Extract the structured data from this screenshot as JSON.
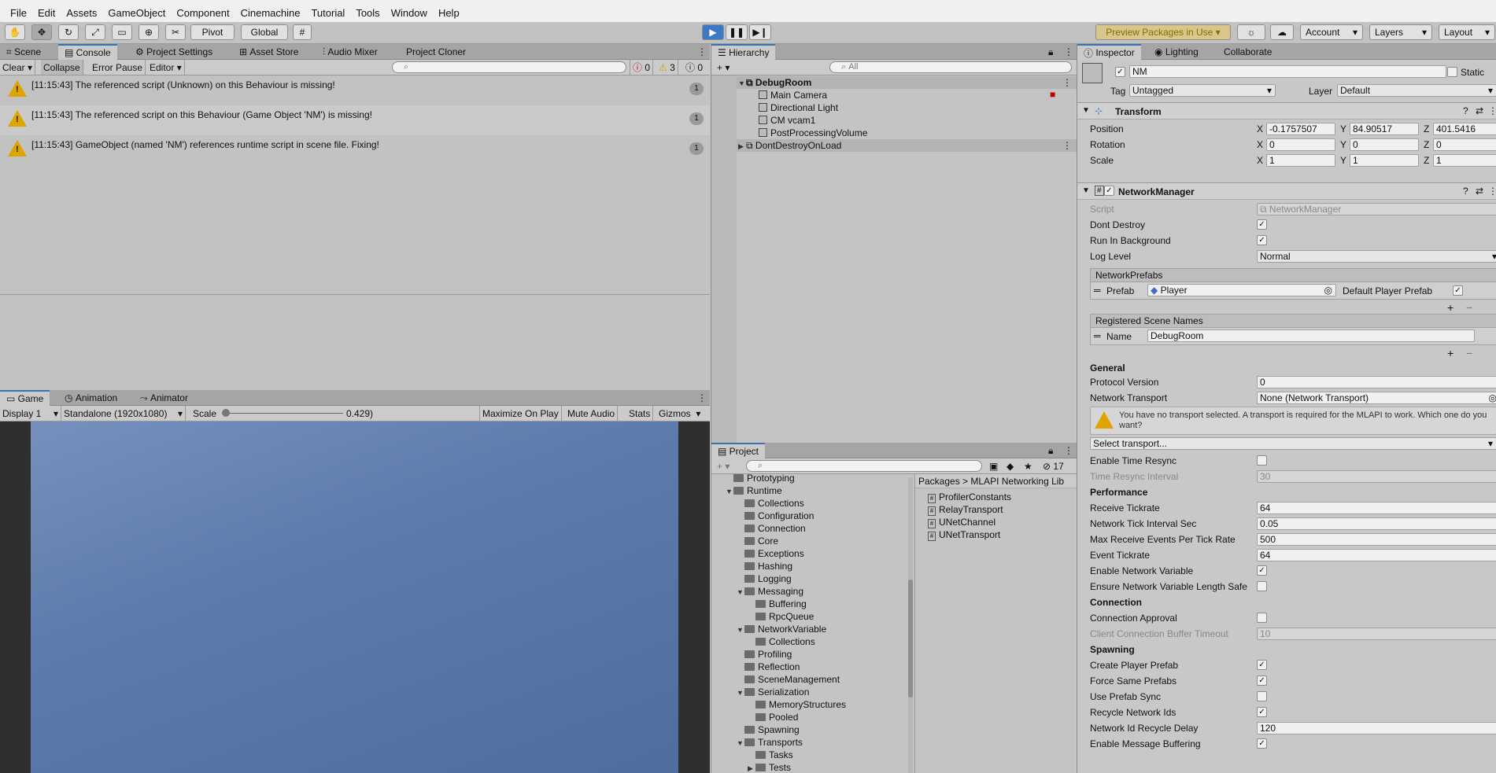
{
  "menu": [
    "File",
    "Edit",
    "Assets",
    "GameObject",
    "Component",
    "Cinemachine",
    "Tutorial",
    "Tools",
    "Window",
    "Help"
  ],
  "toolbar": {
    "pivot": "Pivot",
    "global": "Global",
    "preview_packages": "Preview Packages in Use",
    "account": "Account",
    "layers": "Layers",
    "layout": "Layout"
  },
  "top_tabs": [
    "Scene",
    "Console",
    "Project Settings",
    "Asset Store",
    "Audio Mixer",
    "Project Cloner"
  ],
  "console": {
    "clear": "Clear",
    "collapse": "Collapse",
    "error_pause": "Error Pause",
    "editor": "Editor",
    "err_count": "0",
    "warn_count": "3",
    "info_count": "0",
    "logs": [
      {
        "text": "[11:15:43] The referenced script (Unknown) on this Behaviour is missing!",
        "count": "1"
      },
      {
        "text": "[11:15:43] The referenced script on this Behaviour (Game Object 'NM') is missing!",
        "count": "1"
      },
      {
        "text": "[11:15:43] GameObject (named 'NM') references runtime script in scene file. Fixing!",
        "count": "1"
      }
    ]
  },
  "game_tabs": [
    "Game",
    "Animation",
    "Animator"
  ],
  "game": {
    "display": "Display 1",
    "resolution": "Standalone (1920x1080)",
    "scale_label": "Scale",
    "scale_value": "0.429)",
    "maximize": "Maximize On Play",
    "mute": "Mute Audio",
    "stats": "Stats",
    "gizmos": "Gizmos"
  },
  "hierarchy": {
    "title": "Hierarchy",
    "search": "All",
    "scene": "DebugRoom",
    "children": [
      "Main Camera",
      "Directional Light",
      "CM vcam1",
      "PostProcessingVolume"
    ],
    "ddol": "DontDestroyOnLoad"
  },
  "project": {
    "title": "Project",
    "count": "17",
    "tree": [
      {
        "label": "Prototyping",
        "depth": 1,
        "arrow": ""
      },
      {
        "label": "Runtime",
        "depth": 1,
        "arrow": "▼"
      },
      {
        "label": "Collections",
        "depth": 2,
        "arrow": ""
      },
      {
        "label": "Configuration",
        "depth": 2,
        "arrow": ""
      },
      {
        "label": "Connection",
        "depth": 2,
        "arrow": ""
      },
      {
        "label": "Core",
        "depth": 2,
        "arrow": ""
      },
      {
        "label": "Exceptions",
        "depth": 2,
        "arrow": ""
      },
      {
        "label": "Hashing",
        "depth": 2,
        "arrow": ""
      },
      {
        "label": "Logging",
        "depth": 2,
        "arrow": ""
      },
      {
        "label": "Messaging",
        "depth": 2,
        "arrow": "▼"
      },
      {
        "label": "Buffering",
        "depth": 3,
        "arrow": ""
      },
      {
        "label": "RpcQueue",
        "depth": 3,
        "arrow": ""
      },
      {
        "label": "NetworkVariable",
        "depth": 2,
        "arrow": "▼"
      },
      {
        "label": "Collections",
        "depth": 3,
        "arrow": ""
      },
      {
        "label": "Profiling",
        "depth": 2,
        "arrow": ""
      },
      {
        "label": "Reflection",
        "depth": 2,
        "arrow": ""
      },
      {
        "label": "SceneManagement",
        "depth": 2,
        "arrow": ""
      },
      {
        "label": "Serialization",
        "depth": 2,
        "arrow": "▼"
      },
      {
        "label": "MemoryStructures",
        "depth": 3,
        "arrow": ""
      },
      {
        "label": "Pooled",
        "depth": 3,
        "arrow": ""
      },
      {
        "label": "Spawning",
        "depth": 2,
        "arrow": ""
      },
      {
        "label": "Transports",
        "depth": 2,
        "arrow": "▼"
      },
      {
        "label": "Tasks",
        "depth": 3,
        "arrow": ""
      },
      {
        "label": "Tests",
        "depth": 3,
        "arrow": "▶"
      }
    ],
    "breadcrumb": [
      "Packages",
      "MLAPI Networking Lib"
    ],
    "files": [
      "ProfilerConstants",
      "RelayTransport",
      "UNetChannel",
      "UNetTransport"
    ]
  },
  "inspector": {
    "tabs": [
      "Inspector",
      "Lighting",
      "Collaborate"
    ],
    "name": "NM",
    "static": "Static",
    "tag_label": "Tag",
    "tag": "Untagged",
    "layer_label": "Layer",
    "layer": "Default",
    "transform": {
      "title": "Transform",
      "position": [
        "-0.1757507",
        "84.90517",
        "401.5416"
      ],
      "rotation": [
        "0",
        "0",
        "0"
      ],
      "scale": [
        "1",
        "1",
        "1"
      ],
      "labels": [
        "Position",
        "Rotation",
        "Scale"
      ]
    },
    "nm": {
      "title": "NetworkManager",
      "script_label": "Script",
      "script": "NetworkManager",
      "dont_destroy": "Dont Destroy",
      "run_bg": "Run In Background",
      "log_level_label": "Log Level",
      "log_level": "Normal",
      "prefabs_title": "NetworkPrefabs",
      "prefab_label": "Prefab",
      "prefab": "Player",
      "default_player": "Default Player Prefab",
      "scenes_title": "Registered Scene Names",
      "name_label": "Name",
      "scene_name": "DebugRoom",
      "general": "General",
      "protocol_label": "Protocol Version",
      "protocol": "0",
      "transport_label": "Network Transport",
      "transport": "None (Network Transport)",
      "warning": "You have no transport selected. A transport is required for the MLAPI to work. Which one do you want?",
      "select_transport": "Select transport...",
      "enable_resync": "Enable Time Resync",
      "resync_interval_label": "Time Resync Interval",
      "resync_interval": "30",
      "performance": "Performance",
      "receive_tick_label": "Receive Tickrate",
      "receive_tick": "64",
      "tick_interval_label": "Network Tick Interval Sec",
      "tick_interval": "0.05",
      "max_events_label": "Max Receive Events Per Tick Rate",
      "max_events": "500",
      "event_tick_label": "Event Tickrate",
      "event_tick": "64",
      "enable_nv": "Enable Network Variable",
      "ensure_nv": "Ensure Network Variable Length Safe",
      "connection": "Connection",
      "conn_approval": "Connection Approval",
      "client_buffer_label": "Client Connection Buffer Timeout",
      "client_buffer": "10",
      "spawning": "Spawning",
      "create_player": "Create Player Prefab",
      "force_same": "Force Same Prefabs",
      "use_prefab_sync": "Use Prefab Sync",
      "recycle_ids": "Recycle Network Ids",
      "recycle_delay_label": "Network Id Recycle Delay",
      "recycle_delay": "120",
      "enable_msg_buf": "Enable Message Buffering"
    }
  }
}
